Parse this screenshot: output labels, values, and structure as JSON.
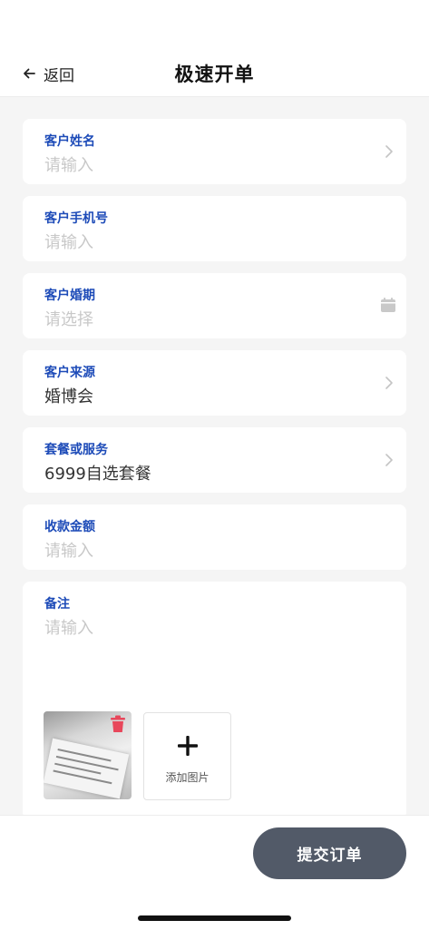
{
  "header": {
    "back_label": "返回",
    "title": "极速开单"
  },
  "fields": [
    {
      "label": "客户姓名",
      "value": "请输入",
      "icon": "chevron-right-icon"
    },
    {
      "label": "客户手机号",
      "value": "请输入"
    },
    {
      "label": "客户婚期",
      "value": "请选择",
      "icon": "calendar-icon"
    },
    {
      "label": "客户来源",
      "value": "婚博会",
      "icon": "chevron-right-icon"
    },
    {
      "label": "套餐或服务",
      "value": "6999自选套餐",
      "icon": "chevron-right-icon"
    },
    {
      "label": "收款金额",
      "value": "请输入"
    }
  ],
  "remarks": {
    "label": "备注",
    "placeholder": "请输入",
    "add_photo_label": "添加图片"
  },
  "footer": {
    "submit_label": "提交订单"
  },
  "colors": {
    "label_blue": "#1d4bb8",
    "placeholder_gray": "#c8c8c8",
    "submit_bg": "#525a68",
    "delete_red": "#e8475b"
  }
}
